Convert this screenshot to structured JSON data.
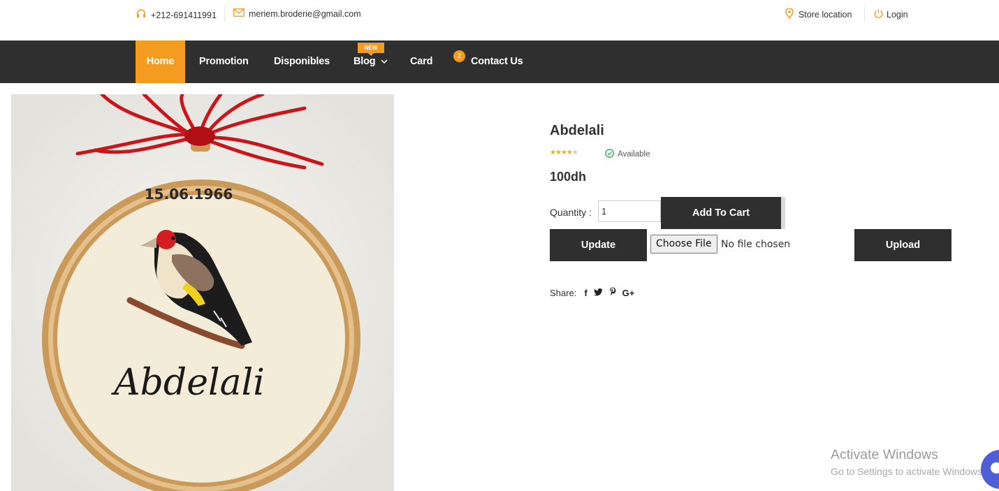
{
  "topbar": {
    "phone": "+212-691411991",
    "email": "meriem.broderie@gmail.com",
    "store_location": "Store location",
    "login": "Login"
  },
  "nav": {
    "items": [
      "Home",
      "Promotion",
      "Disponibles",
      "Blog",
      "Card",
      "Contact Us"
    ],
    "new_badge": "NEW",
    "cart_count": "2",
    "active": "Home"
  },
  "product": {
    "image_text_date": "15.06.1966",
    "image_text_name": "Abdelali",
    "title": "Abdelali",
    "rating": 4,
    "rating_max": 5,
    "availability": "Available",
    "price": "100dh",
    "quantity_label": "Quantity :",
    "quantity_value": "1",
    "add_to_cart": "Add To Cart",
    "update": "Update",
    "choose_file": "Choose File",
    "no_file": "No file chosen",
    "upload": "Upload",
    "share_label": "Share:",
    "share_icons": [
      "facebook-icon",
      "twitter-icon",
      "pinterest-icon",
      "google-plus-icon"
    ]
  },
  "watermark": {
    "title": "Activate Windows",
    "subtitle": "Go to Settings to activate Windows."
  },
  "colors": {
    "accent": "#f39c1f",
    "nav_bg": "#2f2f2f",
    "button_bg": "#2f2f2f",
    "available": "#3aa65a"
  }
}
